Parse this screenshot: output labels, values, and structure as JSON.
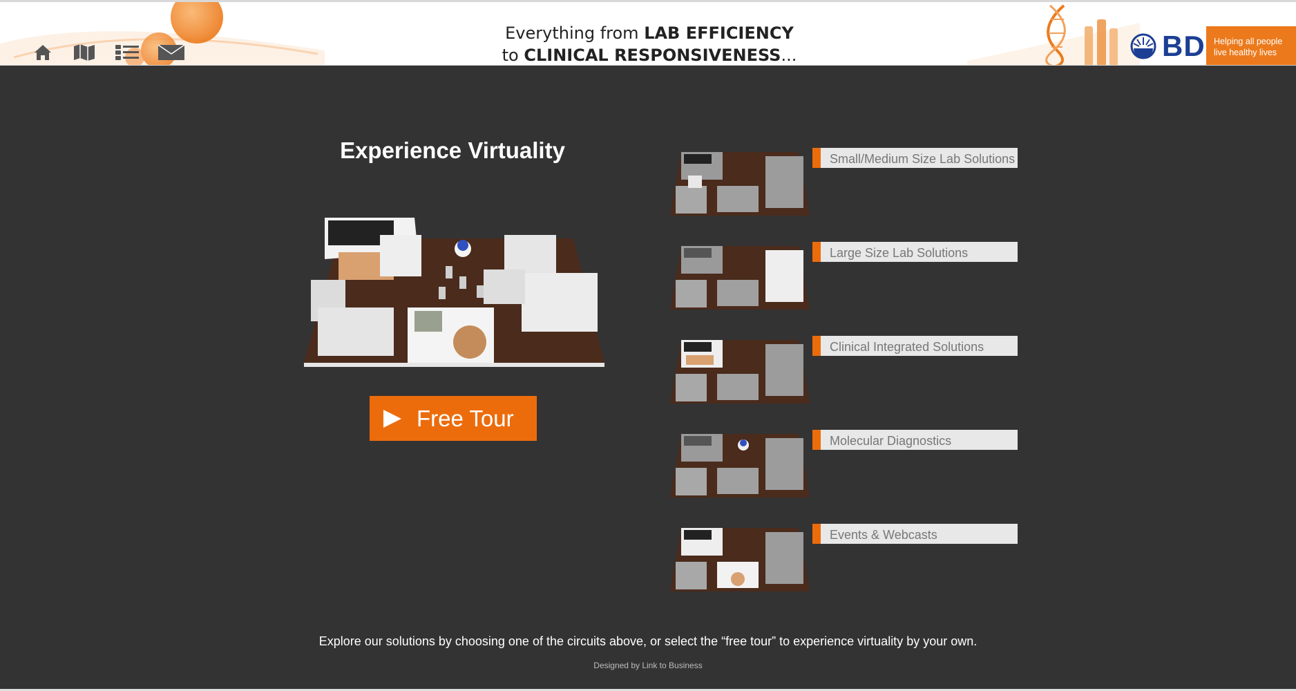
{
  "header": {
    "tagline_line1_prefix": "Everything from ",
    "tagline_line1_bold": "LAB EFFICIENCY",
    "tagline_line2_prefix": "to ",
    "tagline_line2_bold": "CLINICAL RESPONSIVENESS",
    "tagline_line2_suffix": "...",
    "nav_icons": [
      "home-icon",
      "map-icon",
      "list-icon",
      "mail-icon"
    ],
    "brand": {
      "logo_text": "BD",
      "slogan_line1": "Helping all people",
      "slogan_line2": "live healthy lives"
    }
  },
  "main": {
    "title": "Experience Virtuality",
    "tour_button_label": "Free Tour",
    "circuits": [
      {
        "label": "Small/Medium Size Lab Solutions"
      },
      {
        "label": "Large Size Lab Solutions"
      },
      {
        "label": "Clinical Integrated Solutions"
      },
      {
        "label": "Molecular Diagnostics"
      },
      {
        "label": "Events & Webcasts"
      }
    ]
  },
  "footer": {
    "instructions": "Explore our solutions by choosing one of the circuits above, or select the “free tour” to experience virtuality by your own.",
    "credit": "Designed by Link to Business"
  },
  "colors": {
    "accent": "#ec6c0c",
    "background": "#333333",
    "brand_blue": "#1c3f94",
    "label_bar": "#e8e8e8"
  }
}
